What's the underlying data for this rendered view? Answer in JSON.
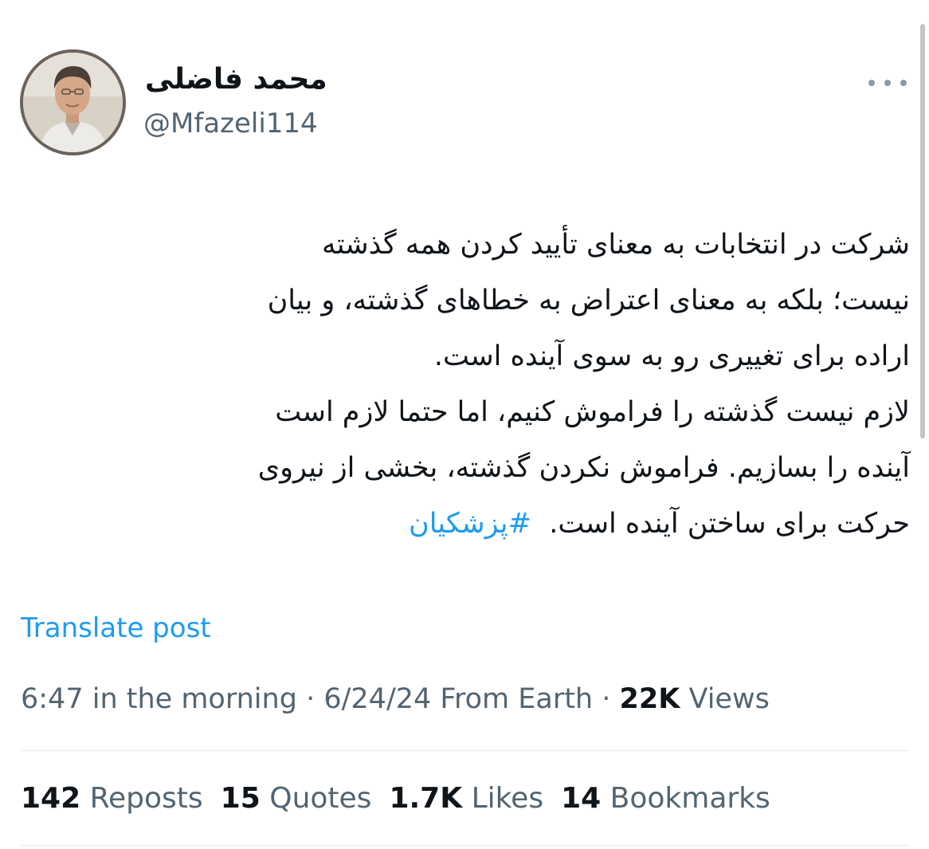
{
  "author": {
    "display_name": "محمد فاضلی",
    "handle": "@Mfazeli114",
    "avatar_icon": "profile-photo"
  },
  "more_icon": "more-horizontal-icon",
  "tweet": {
    "lines": [
      "شرکت در انتخابات به معنای تأیید کردن همه گذشته",
      "نیست؛ بلکه به معنای اعتراض به خطاهای گذشته، و بیان",
      "اراده برای تغییری رو به سوی آینده است.",
      "لازم نیست گذشته را فراموش کنیم، اما حتما لازم است",
      "آینده را بسازیم. فراموش نکردن گذشته، بخشی از نیروی"
    ],
    "last_line_text": "حرکت برای ساختن آینده است.",
    "hashtag": "#پزشکیان"
  },
  "translate_label": "Translate post",
  "meta": {
    "time": "6:47 in the morning",
    "separator": "·",
    "date": "6/24/24",
    "source": "From Earth",
    "views_count": "22K",
    "views_label": "Views"
  },
  "stats": {
    "reposts_count": "142",
    "reposts_label": "Reposts",
    "quotes_count": "15",
    "quotes_label": "Quotes",
    "likes_count": "1.7K",
    "likes_label": "Likes",
    "bookmarks_count": "14",
    "bookmarks_label": "Bookmarks"
  },
  "colors": {
    "link": "#1d9bf0",
    "text": "#0f1419",
    "secondary": "#536471",
    "divider": "#e1e8ed"
  }
}
